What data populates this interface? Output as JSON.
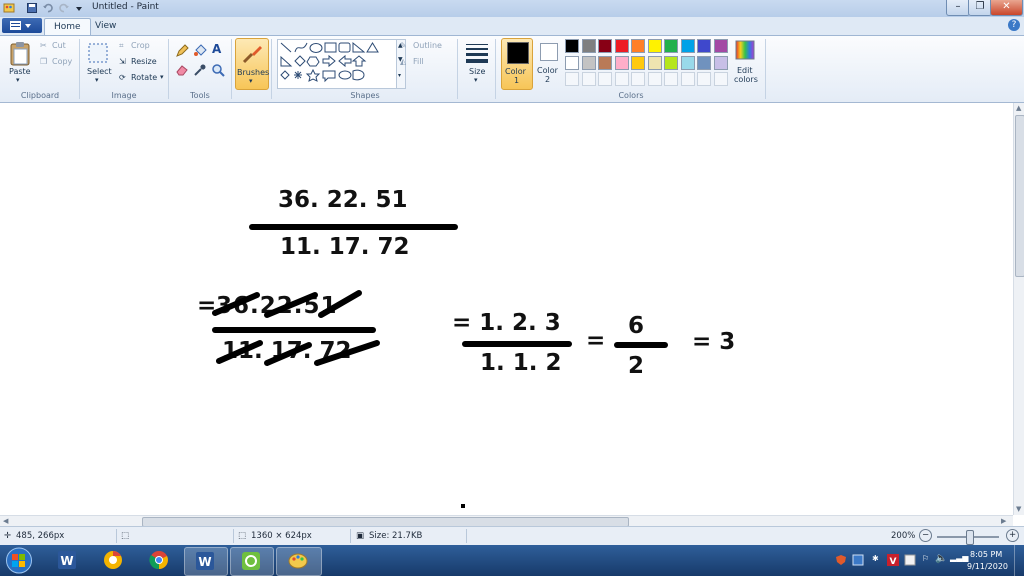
{
  "window": {
    "title": "Untitled - Paint",
    "minimize": "–",
    "restore": "❐",
    "close": "✕"
  },
  "tabs": [
    {
      "label": "Home"
    },
    {
      "label": "View"
    }
  ],
  "help": "?",
  "ribbon": {
    "clipboard": {
      "label": "Clipboard",
      "paste": "Paste",
      "cut": "Cut",
      "copy": "Copy"
    },
    "image": {
      "label": "Image",
      "select": "Select",
      "crop": "Crop",
      "resize": "Resize",
      "rotate": "Rotate"
    },
    "tools": {
      "label": "Tools"
    },
    "brushes": {
      "label": "Brushes"
    },
    "shapes": {
      "label": "Shapes",
      "outline": "Outline",
      "fill": "Fill"
    },
    "size": {
      "label": "Size"
    },
    "color1": {
      "label": "Color",
      "num": "1",
      "value": "#000000"
    },
    "color2": {
      "label": "Color",
      "num": "2",
      "value": "#ffffff"
    },
    "colors": {
      "label": "Colors",
      "edit_line1": "Edit",
      "edit_line2": "colors",
      "row1": [
        "#000000",
        "#7f7f7f",
        "#880015",
        "#ed1c24",
        "#ff7f27",
        "#fff200",
        "#22b14c",
        "#00a2e8",
        "#3f48cc",
        "#a349a4"
      ],
      "row2": [
        "#ffffff",
        "#c3c3c3",
        "#b97a57",
        "#ffaec9",
        "#ffc90e",
        "#efe4b0",
        "#b5e61d",
        "#99d9ea",
        "#7092be",
        "#c8bfe7"
      ]
    }
  },
  "canvas": {
    "eq1_num": "36. 22. 51",
    "eq1_den": "11. 17. 72",
    "eq2_num": "36.22.51",
    "eq2_den": "11. 17. 72",
    "eq2_prefix": "=",
    "eq3_num": "= 1. 2. 3",
    "eq3_den": "1. 1. 2",
    "eq4_eq": "=",
    "eq4_num": "6",
    "eq4_den": "2",
    "eq5": "= 3"
  },
  "status": {
    "cursor": "485, 266px",
    "dimensions": "1360 × 624px",
    "size": "Size: 21.7KB",
    "zoom": "200%",
    "zoom_out": "−",
    "zoom_in": "+"
  },
  "tray": {
    "time": "8:05 PM",
    "date": "9/11/2020"
  }
}
